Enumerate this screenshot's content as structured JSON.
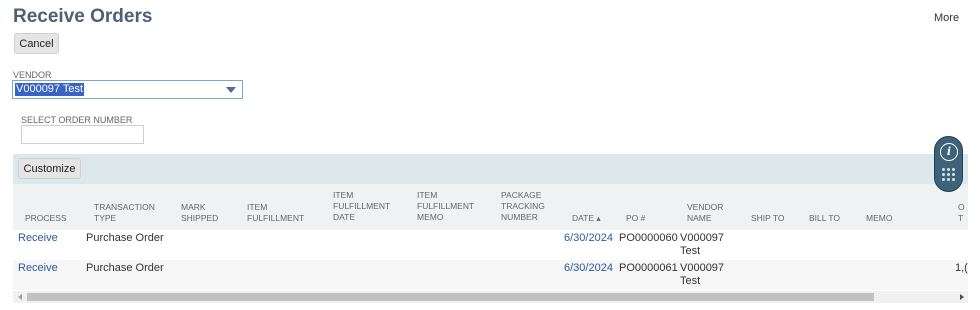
{
  "header": {
    "title": "Receive Orders",
    "more_label": "More"
  },
  "actions": {
    "cancel_label": "Cancel"
  },
  "vendor": {
    "label": "VENDOR",
    "selected_value": "V000097 Test"
  },
  "order_number": {
    "label": "SELECT ORDER NUMBER",
    "value": ""
  },
  "toolbar": {
    "customize_label": "Customize"
  },
  "table": {
    "columns": {
      "process": "PROCESS",
      "transaction_type": "TRANSACTION TYPE",
      "mark_shipped": "MARK SHIPPED",
      "item_fulfillment": "ITEM FULFILLMENT",
      "item_fulfillment_date": "ITEM FULFILLMENT DATE",
      "item_fulfillment_memo": "ITEM FULFILLMENT MEMO",
      "package_tracking_number": "PACKAGE TRACKING NUMBER",
      "date": "DATE ▴",
      "po_number": "PO #",
      "vendor_name": "VENDOR NAME",
      "ship_to": "SHIP TO",
      "bill_to": "BILL TO",
      "memo": "MEMO",
      "cut_off": "O T"
    },
    "rows": [
      {
        "process": "Receive",
        "transaction_type": "Purchase Order",
        "date": "6/30/2024",
        "po_number": "PO0000060",
        "vendor_name": "V000097 Test",
        "cut_off": ""
      },
      {
        "process": "Receive",
        "transaction_type": "Purchase Order",
        "date": "6/30/2024",
        "po_number": "PO0000061",
        "vendor_name": "V000097 Test",
        "cut_off": "1,("
      }
    ]
  },
  "widget": {
    "info_glyph": "i",
    "icons": [
      "info-icon",
      "dial-pad-icon"
    ]
  },
  "colors": {
    "title": "#4d5f79",
    "link": "#2b5c9c",
    "toolbar_bg": "#dde8ed",
    "selection": "#3a63c4"
  }
}
